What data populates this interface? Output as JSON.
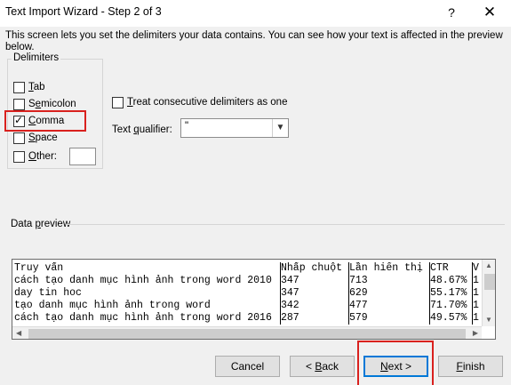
{
  "window": {
    "title": "Text Import Wizard - Step 2 of 3",
    "help_label": "?",
    "close_label": "✕"
  },
  "instructions": "This screen lets you set the delimiters your data contains.  You can see how your text is affected in the preview below.",
  "delimiters": {
    "group_label": "Delimiters",
    "tab": {
      "mn": "T",
      "rest": "ab",
      "checked": false
    },
    "semicolon": {
      "pre": "S",
      "mn": "e",
      "rest": "micolon",
      "checked": false
    },
    "comma": {
      "mn": "C",
      "rest": "omma",
      "checked": true
    },
    "space": {
      "mn": "S",
      "rest": "pace",
      "checked": false
    },
    "other": {
      "mn": "O",
      "rest": "ther:",
      "checked": false,
      "value": ""
    }
  },
  "consecutive": {
    "mn": "T",
    "rest": "reat consecutive delimiters as one",
    "checked": false
  },
  "qualifier": {
    "pre": "Text ",
    "mn": "q",
    "rest": "ualifier:",
    "value": "\""
  },
  "preview": {
    "label_pre": "Data ",
    "label_mn": "p",
    "label_rest": "review",
    "rows": [
      [
        "Truy vấn",
        "Nhấp chuột",
        "Lần hiển thị",
        "CTR",
        "V"
      ],
      [
        "cách tạo danh mục hình ảnh trong word 2010",
        "347",
        "713",
        "48.67%",
        "1"
      ],
      [
        "day tin hoc",
        "347",
        "629",
        "55.17%",
        "1"
      ],
      [
        "tạo danh mục hình ảnh trong word",
        "342",
        "477",
        "71.70%",
        "1"
      ],
      [
        "cách tạo danh mục hình ảnh trong word 2016",
        "287",
        "579",
        "49.57%",
        "1"
      ]
    ]
  },
  "buttons": {
    "cancel": {
      "label": "Cancel"
    },
    "back": {
      "pre": "< ",
      "mn": "B",
      "rest": "ack"
    },
    "next": {
      "mn": "N",
      "rest": "ext >"
    },
    "finish": {
      "mn": "F",
      "rest": "inish"
    }
  },
  "colors": {
    "highlight": "#d9211e",
    "default_button_border": "#0078d7",
    "background": "#f0f0f0"
  }
}
